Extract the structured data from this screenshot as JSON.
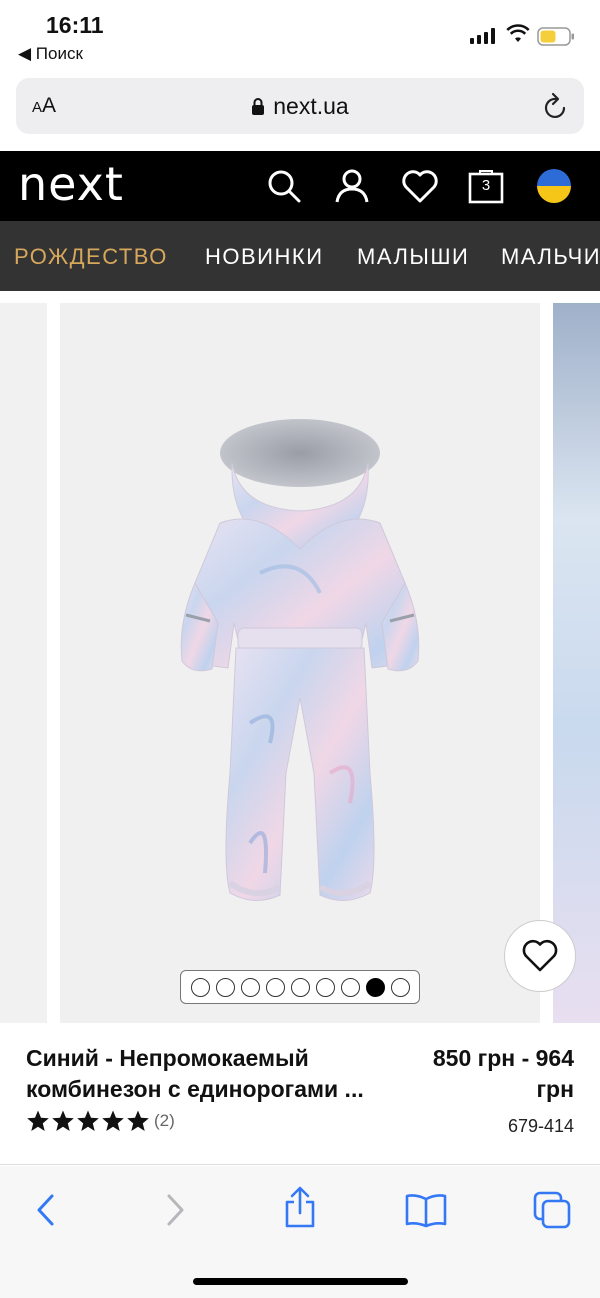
{
  "status": {
    "time": "16:11",
    "back_label": "◀ Поиск"
  },
  "browser": {
    "text_size_label_small": "A",
    "text_size_label_large": "A",
    "url": "next.ua"
  },
  "site": {
    "logo": "next",
    "cart_count": "3",
    "nav": [
      {
        "label": "РОЖДЕСТВО",
        "active": true
      },
      {
        "label": "НОВИНКИ",
        "active": false
      },
      {
        "label": "МАЛЫШИ",
        "active": false
      },
      {
        "label": "МАЛЬЧИ",
        "active": false
      }
    ]
  },
  "gallery": {
    "total_images": 9,
    "active_index": 7
  },
  "product": {
    "title": "Синий - Непромокаемый комбинезон с единорогами ...",
    "price": "850 грн - 964 грн",
    "rating": 5,
    "reviews": "(2)",
    "code": "679-414"
  },
  "colors": {
    "header_bg": "#000000",
    "nav_bg": "#333333",
    "nav_active": "#d7a85b",
    "safari_blue": "#3478f6"
  }
}
